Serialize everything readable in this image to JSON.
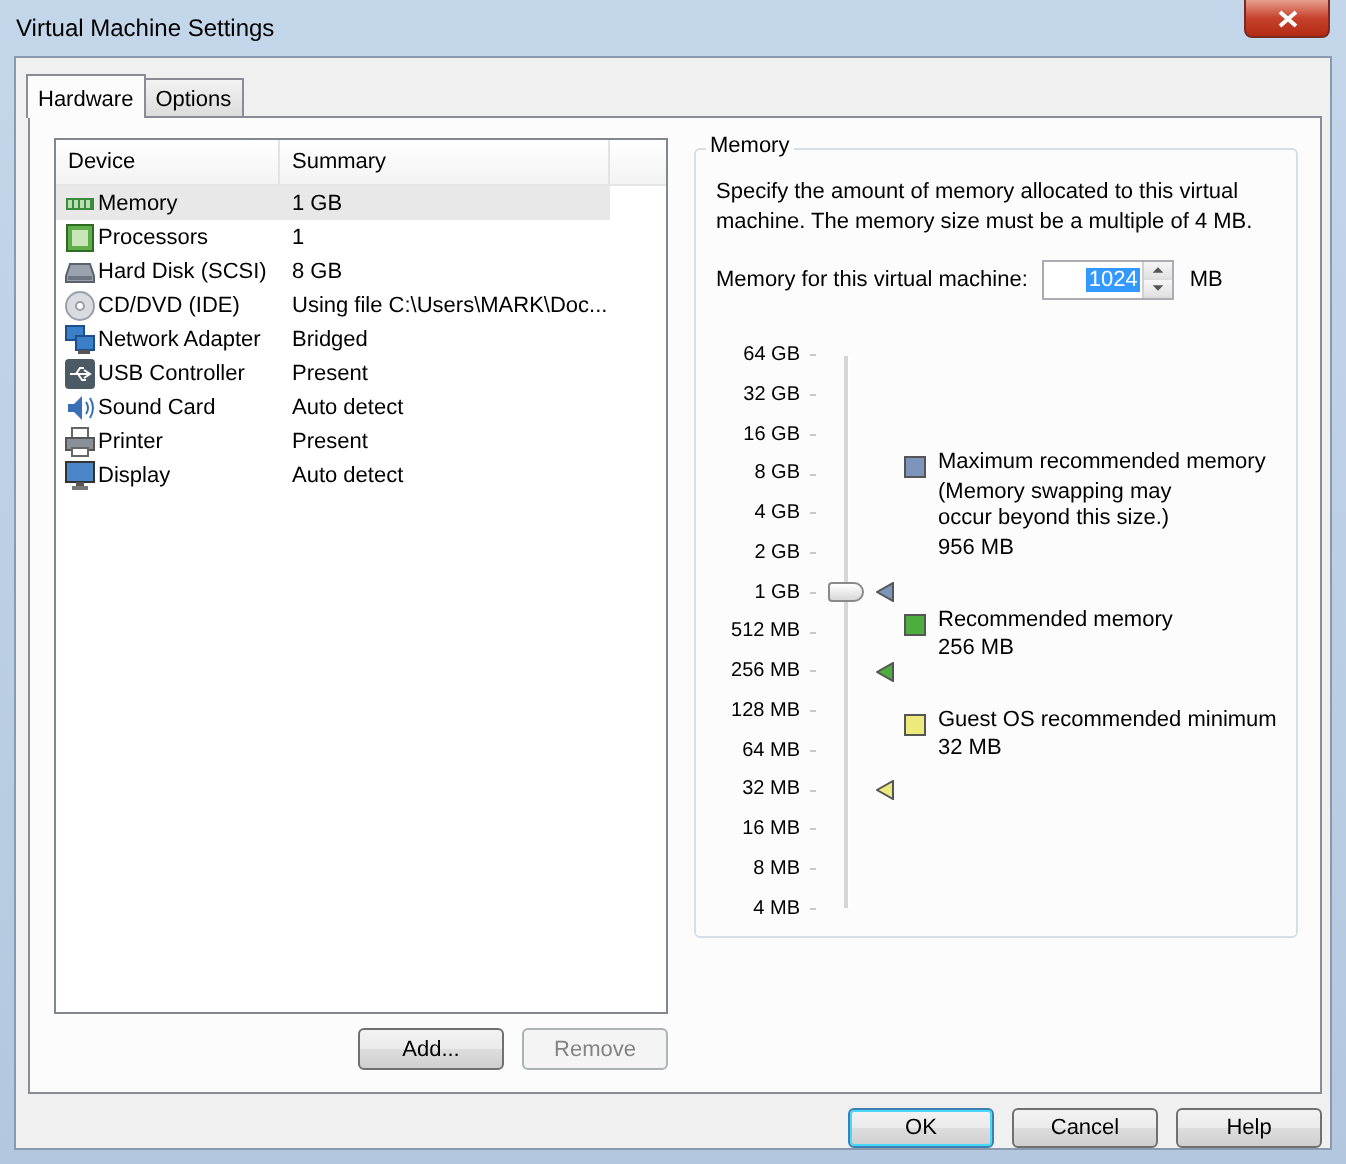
{
  "window": {
    "title": "Virtual Machine Settings"
  },
  "tabs": [
    {
      "label": "Hardware",
      "selected": true
    },
    {
      "label": "Options",
      "selected": false
    }
  ],
  "device_table": {
    "columns": [
      "Device",
      "Summary"
    ],
    "rows": [
      {
        "device": "Memory",
        "summary": "1 GB",
        "selected": true
      },
      {
        "device": "Processors",
        "summary": "1",
        "selected": false
      },
      {
        "device": "Hard Disk (SCSI)",
        "summary": "8 GB",
        "selected": false
      },
      {
        "device": "CD/DVD (IDE)",
        "summary": "Using file C:\\Users\\MARK\\Doc...",
        "selected": false
      },
      {
        "device": "Network Adapter",
        "summary": "Bridged",
        "selected": false
      },
      {
        "device": "USB Controller",
        "summary": "Present",
        "selected": false
      },
      {
        "device": "Sound Card",
        "summary": "Auto detect",
        "selected": false
      },
      {
        "device": "Printer",
        "summary": "Present",
        "selected": false
      },
      {
        "device": "Display",
        "summary": "Auto detect",
        "selected": false
      }
    ]
  },
  "device_buttons": [
    {
      "label": "Add...",
      "disabled": false
    },
    {
      "label": "Remove",
      "disabled": true
    }
  ],
  "memory": {
    "title": "Memory",
    "description": "Specify the amount of memory allocated to this virtual machine. The memory size must be a multiple of 4 MB.",
    "field_label": "Memory for this virtual machine:",
    "value": "1024",
    "unit": "MB",
    "scale_labels": [
      "64 GB",
      "32 GB",
      "16 GB",
      "8 GB",
      "4 GB",
      "2 GB",
      "1 GB",
      "512 MB",
      "256 MB",
      "128 MB",
      "64 MB",
      "32 MB",
      "16 MB",
      "8 MB",
      "4 MB"
    ],
    "slider": {
      "level": 0.5714
    },
    "legend": [
      {
        "label": "Maximum recommended memory",
        "note": "(Memory swapping may occur beyond this size.)",
        "value": "956 MB",
        "color": "#7d95bd",
        "level": 0.5714
      },
      {
        "label": "Recommended memory",
        "value": "256 MB",
        "color": "#4cae3c",
        "level": 0.4286
      },
      {
        "label": "Guest OS recommended minimum",
        "value": "32 MB",
        "color": "#ecea7c",
        "level": 0.2143
      }
    ]
  },
  "dialog_buttons": [
    {
      "label": "OK",
      "default": true
    },
    {
      "label": "Cancel",
      "default": false
    },
    {
      "label": "Help",
      "default": false
    }
  ]
}
